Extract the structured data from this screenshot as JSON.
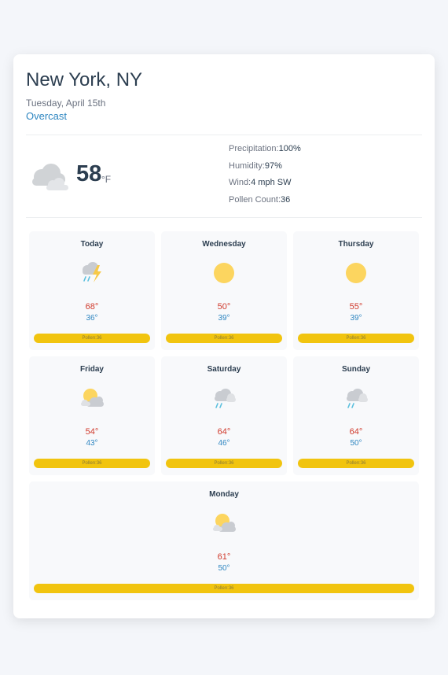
{
  "header": {
    "city": "New York, NY",
    "date": "Tuesday, April 15th",
    "condition": "Overcast"
  },
  "current": {
    "icon": "cloud-icon",
    "temperature": "58",
    "unit": "°F",
    "stats": [
      {
        "label": "Precipitation:",
        "value": "100%"
      },
      {
        "label": "Humidity:",
        "value": "97%"
      },
      {
        "label": "Wind:",
        "value": "4 mph SW"
      },
      {
        "label": "Pollen Count:",
        "value": "36"
      }
    ]
  },
  "forecast": [
    {
      "day": "Today",
      "icon": "thunderstorm-icon",
      "high": "68°",
      "low": "36°",
      "pollen": "Pollen:36"
    },
    {
      "day": "Wednesday",
      "icon": "sun-icon",
      "high": "50°",
      "low": "39°",
      "pollen": "Pollen:36"
    },
    {
      "day": "Thursday",
      "icon": "sun-icon",
      "high": "55°",
      "low": "39°",
      "pollen": "Pollen:36"
    },
    {
      "day": "Friday",
      "icon": "partly-cloudy-icon",
      "high": "54°",
      "low": "43°",
      "pollen": "Pollen:36"
    },
    {
      "day": "Saturday",
      "icon": "rain-icon",
      "high": "64°",
      "low": "46°",
      "pollen": "Pollen:36"
    },
    {
      "day": "Sunday",
      "icon": "rain-icon",
      "high": "64°",
      "low": "50°",
      "pollen": "Pollen:36"
    },
    {
      "day": "Monday",
      "icon": "partly-cloudy-icon",
      "high": "61°",
      "low": "50°",
      "pollen": "Pollen:36"
    }
  ],
  "colors": {
    "high": "#d0392b",
    "low": "#2e86c1",
    "pollen_bar": "#f1c40f",
    "sun": "#fcd55f"
  }
}
